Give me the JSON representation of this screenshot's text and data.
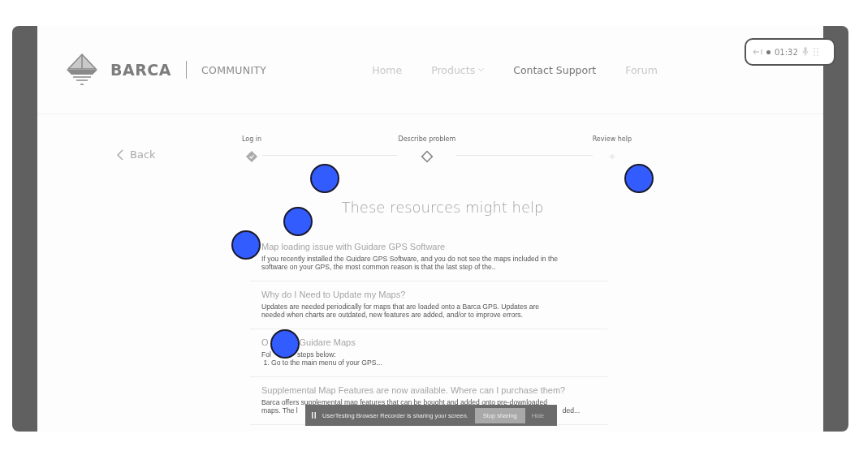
{
  "logo": {
    "brand": "BARCA",
    "sub": "COMMUNITY"
  },
  "nav": [
    {
      "label": "Home",
      "selected": false,
      "dropdown": false
    },
    {
      "label": "Products",
      "selected": false,
      "dropdown": true
    },
    {
      "label": "Contact Support",
      "selected": true,
      "dropdown": false
    },
    {
      "label": "Forum",
      "selected": false,
      "dropdown": false
    }
  ],
  "recorder": {
    "time": "01:32"
  },
  "back": {
    "label": "Back"
  },
  "steps": [
    {
      "label": "Log in",
      "completed": true,
      "selected": false
    },
    {
      "label": "Describe problem",
      "completed": false,
      "selected": true
    },
    {
      "label": "Review help",
      "completed": false,
      "selected": false
    }
  ],
  "heading": "These resources might help",
  "articles": [
    {
      "title": [
        "Map loading issue with Guidare GPS Software"
      ],
      "lines": [
        [
          "If you recently installed the Guidare GPS Software, and you do not see the maps included in the"
        ],
        [
          "software on your GPS, the most common reason is that the last step of the.."
        ]
      ]
    },
    {
      "title": [
        "Why do I Need to Update my Maps?"
      ],
      "lines": [
        [
          "Updates are needed periodically for maps that are loaded onto a Barca GPS. Updates are"
        ],
        [
          "needed when charts are outdated, new features are added, and/or to improve errors."
        ]
      ]
    },
    {
      "title": [
        "O",
        "Guidare Maps"
      ],
      "lines": [
        [
          "Fol",
          "steps below:"
        ],
        [
          " 1. Go to the main menu of your GPS..."
        ]
      ]
    },
    {
      "title": [
        "Supplemental Map Features are now available. Where can I purchase them?"
      ],
      "lines": [
        [
          "Barca offers supplemental map features that can be bought and added onto pre-downloaded"
        ],
        [
          "maps. The l",
          "ded..."
        ]
      ]
    }
  ],
  "share_bar": {
    "message": "UserTesting Browser Recorder is sharing your screen.",
    "stop": "Stop sharing",
    "hide": "Hide"
  }
}
